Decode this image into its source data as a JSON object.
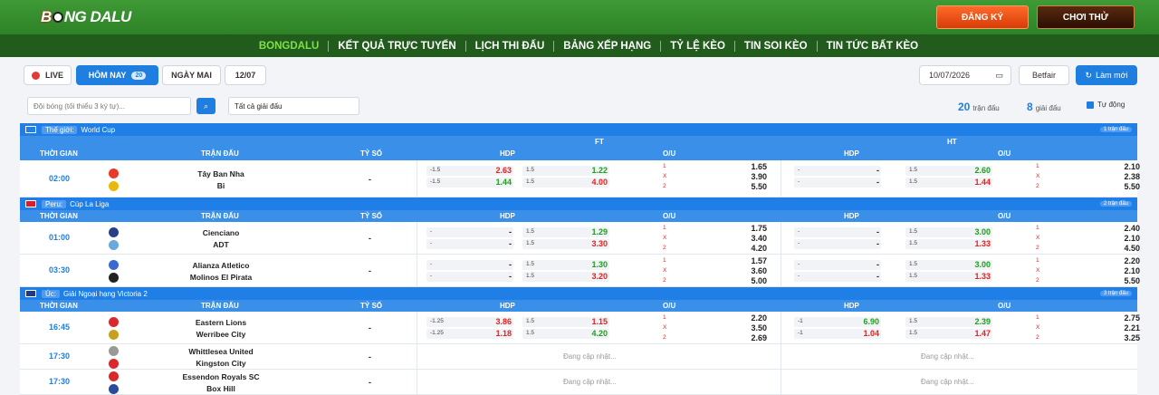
{
  "header": {
    "logo_a": "B",
    "logo_b": "NG",
    "logo_c": "DALU",
    "register": "ĐĂNG KÝ",
    "play": "CHƠI THỬ"
  },
  "nav": [
    "BONGDALU",
    "KẾT QUẢ TRỰC TUYẾN",
    "LỊCH THI ĐẤU",
    "BẢNG XẾP HẠNG",
    "TỶ LỆ KÈO",
    "TIN SOI KÈO",
    "TIN TỨC BẤT KÈO"
  ],
  "toolbar": {
    "live": "LIVE",
    "today": "HÔM NAY",
    "today_count": "20",
    "tomorrow": "NGÀY MAI",
    "date_tab": "12/07",
    "date_input": "10/07/2026",
    "bookmaker": "Betfair",
    "refresh": "Làm mới"
  },
  "filter": {
    "team_placeholder": "Đội bóng (tối thiểu 3 ký tự)...",
    "league": "Tất cả giải đấu",
    "matches_n": "20",
    "matches_l": "trận đấu",
    "leagues_n": "8",
    "leagues_l": "giải đấu",
    "auto": "Tự động"
  },
  "headers": {
    "ft": "FT",
    "ht": "HT",
    "time": "THỜI GIAN",
    "match": "TRẬN ĐẤU",
    "score": "TỶ SỐ",
    "hdp": "HDP",
    "ou": "O/U"
  },
  "leagues": [
    {
      "tag": "Thế giới:",
      "name": "World Cup",
      "count": "1 trận đấu",
      "flag": "#1f7fe6"
    },
    {
      "tag": "Peru:",
      "name": "Cúp La Liga",
      "count": "2 trận đấu",
      "flag": "#d91e2a"
    },
    {
      "tag": "Úc:",
      "name": "Giải Ngoại hạng Victoria 2",
      "count": "3 trận đấu",
      "flag": "#1c3a8a"
    }
  ],
  "matches": [
    {
      "time": "02:00",
      "home": "Tây Ban Nha",
      "away": "Bỉ",
      "score": "-",
      "c1": "#e8392a",
      "c2": "#e8b80e",
      "ft_hdp": {
        "l": "-1.5",
        "h": "2.63",
        "a": "1.44",
        "hc": "r",
        "ac": "g"
      },
      "ft_ou": {
        "l": "1.5",
        "h": "1.22",
        "a": "4.00",
        "hc": "g",
        "ac": "r"
      },
      "ft_1x2": [
        "1.65",
        "3.90",
        "5.50"
      ],
      "ht_hdp": {
        "l": "-",
        "h": "-",
        "a": "-"
      },
      "ht_ou": {
        "l": "1.5",
        "h": "2.60",
        "a": "1.44",
        "hc": "g",
        "ac": "r"
      },
      "ht_1x2": [
        "2.10",
        "2.38",
        "5.50"
      ]
    },
    {
      "time": "01:00",
      "home": "Cienciano",
      "away": "ADT",
      "score": "-",
      "c1": "#2a3f8a",
      "c2": "#6aa8e0",
      "ft_hdp": {
        "l": "-",
        "h": "-",
        "a": "-"
      },
      "ft_ou": {
        "l": "1.5",
        "h": "1.29",
        "a": "3.30",
        "hc": "g",
        "ac": "r"
      },
      "ft_1x2": [
        "1.75",
        "3.40",
        "4.20"
      ],
      "ht_hdp": {
        "l": "-",
        "h": "-",
        "a": "-"
      },
      "ht_ou": {
        "l": "1.5",
        "h": "3.00",
        "a": "1.33",
        "hc": "g",
        "ac": "r"
      },
      "ht_1x2": [
        "2.40",
        "2.10",
        "4.50"
      ]
    },
    {
      "time": "03:30",
      "home": "Alianza Atletico",
      "away": "Molinos El Pirata",
      "score": "-",
      "c1": "#3a6ad0",
      "c2": "#222",
      "ft_hdp": {
        "l": "-",
        "h": "-",
        "a": "-"
      },
      "ft_ou": {
        "l": "1.5",
        "h": "1.30",
        "a": "3.20",
        "hc": "g",
        "ac": "r"
      },
      "ft_1x2": [
        "1.57",
        "3.60",
        "5.00"
      ],
      "ht_hdp": {
        "l": "-",
        "h": "-",
        "a": "-"
      },
      "ht_ou": {
        "l": "1.5",
        "h": "3.00",
        "a": "1.33",
        "hc": "g",
        "ac": "r"
      },
      "ht_1x2": [
        "2.20",
        "2.10",
        "5.50"
      ]
    },
    {
      "time": "16:45",
      "home": "Eastern Lions",
      "away": "Werribee City",
      "score": "-",
      "c1": "#d82a2a",
      "c2": "#c8a020",
      "ft_hdp": {
        "l": "-1.25",
        "h": "3.86",
        "a": "1.18",
        "hc": "r",
        "ac": "r"
      },
      "ft_ou": {
        "l": "1.5",
        "h": "1.15",
        "a": "4.20",
        "hc": "r",
        "ac": "g"
      },
      "ft_1x2": [
        "2.20",
        "3.50",
        "2.69"
      ],
      "ht_hdp": {
        "l": "-1",
        "h": "6.90",
        "a": "1.04",
        "hc": "g",
        "ac": "r"
      },
      "ht_ou": {
        "l": "1.5",
        "h": "2.39",
        "a": "1.47",
        "hc": "g",
        "ac": "r"
      },
      "ht_1x2": [
        "2.75",
        "2.21",
        "3.25"
      ]
    },
    {
      "time": "17:30",
      "home": "Whittlesea United",
      "away": "Kingston City",
      "score": "-",
      "c1": "#999",
      "c2": "#d82a2a",
      "pending": "Đang cập nhật..."
    },
    {
      "time": "17:30",
      "home": "Essendon Royals SC",
      "away": "Box Hill",
      "score": "-",
      "c1": "#d82a2a",
      "c2": "#2a4a9a",
      "pending": "Đang cập nhật..."
    }
  ],
  "x12": [
    "1",
    "X",
    "2"
  ]
}
